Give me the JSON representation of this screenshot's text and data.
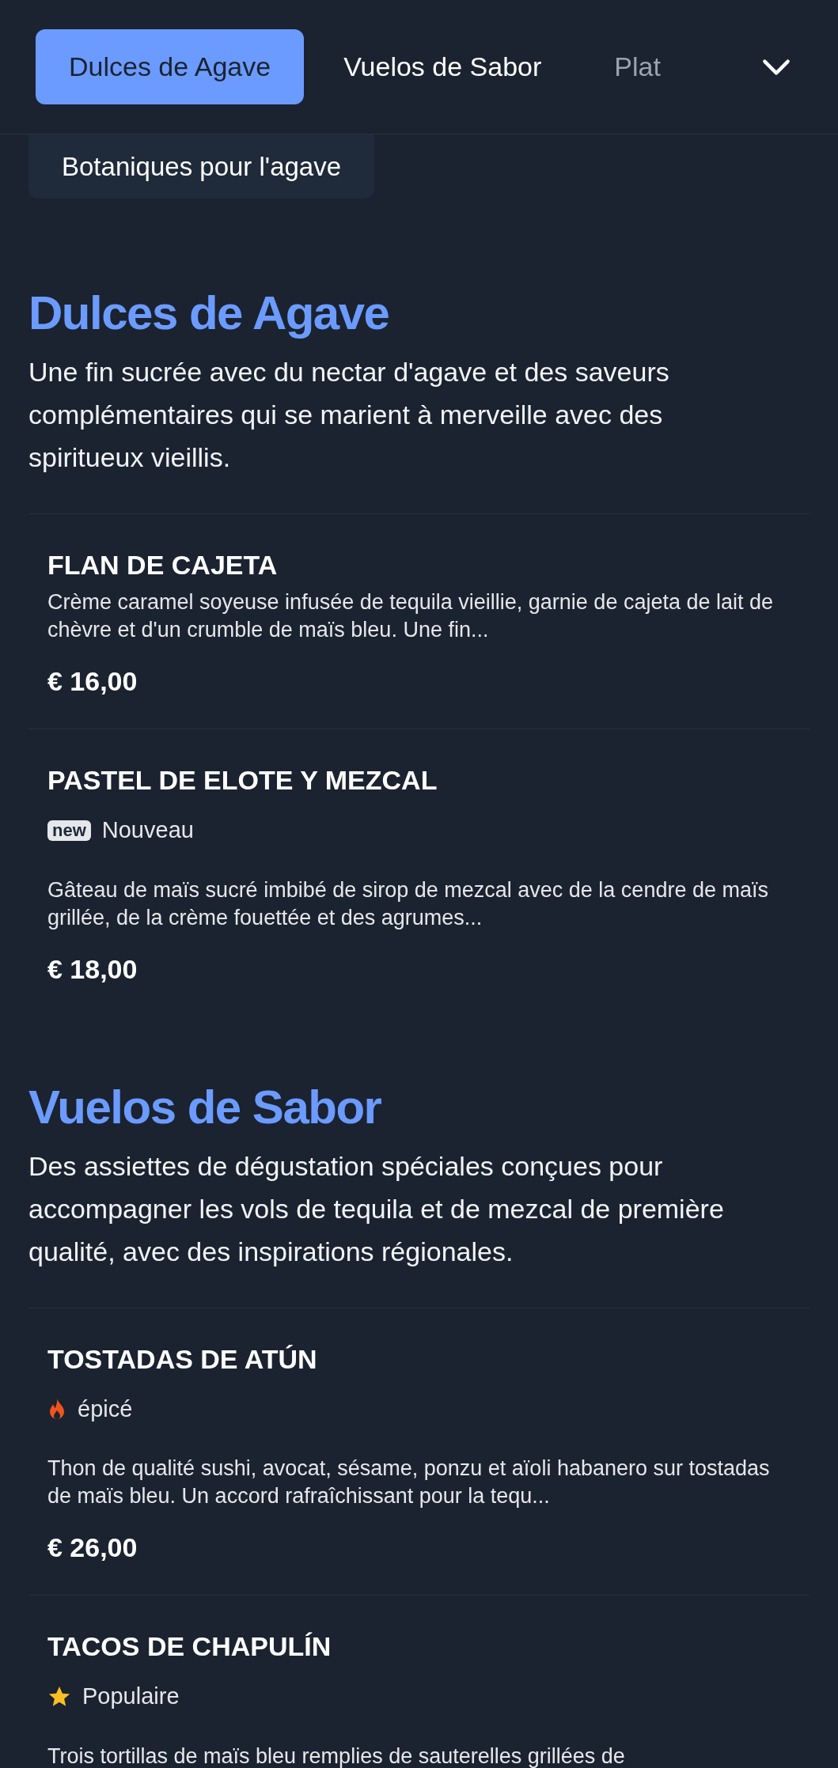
{
  "nav": {
    "tabs": [
      {
        "label": "Dulces de Agave",
        "selected": true
      },
      {
        "label": "Vuelos de Sabor",
        "selected": false
      },
      {
        "label": "Plat",
        "selected": false
      }
    ]
  },
  "subnav": {
    "chip": "Botaniques pour l'agave"
  },
  "sections": [
    {
      "title": "Dulces de Agave",
      "description": "Une fin sucrée avec du nectar d'agave et des saveurs complémentaires qui se marient à merveille avec des spiritueux vieillis.",
      "items": [
        {
          "name": "FLAN DE CAJETA",
          "description": "Crème caramel soyeuse infusée de tequila vieillie, garnie de cajeta de lait de chèvre et d'un crumble de maïs bleu. Une fin...",
          "price": "€ 16,00"
        },
        {
          "name": "PASTEL DE ELOTE Y MEZCAL",
          "tag": {
            "kind": "new",
            "badge": "new",
            "label": "Nouveau"
          },
          "description": "Gâteau de maïs sucré imbibé de sirop de mezcal avec de la cendre de maïs grillée, de la crème fouettée et des agrumes...",
          "price": "€ 18,00"
        }
      ]
    },
    {
      "title": "Vuelos de Sabor",
      "description": "Des assiettes de dégustation spéciales conçues pour accompagner les vols de tequila et de mezcal de première qualité, avec des inspirations régionales.",
      "items": [
        {
          "name": "TOSTADAS DE ATÚN",
          "tag": {
            "kind": "spicy",
            "label": "épicé"
          },
          "description": "Thon de qualité sushi, avocat, sésame, ponzu et aïoli habanero sur tostadas de maïs bleu. Un accord rafraîchissant pour la tequ...",
          "price": "€ 26,00"
        },
        {
          "name": "TACOS DE CHAPULÍN",
          "tag": {
            "kind": "popular",
            "label": "Populaire"
          },
          "description": "Trois tortillas de maïs bleu remplies de sauterelles grillées de"
        }
      ]
    }
  ]
}
